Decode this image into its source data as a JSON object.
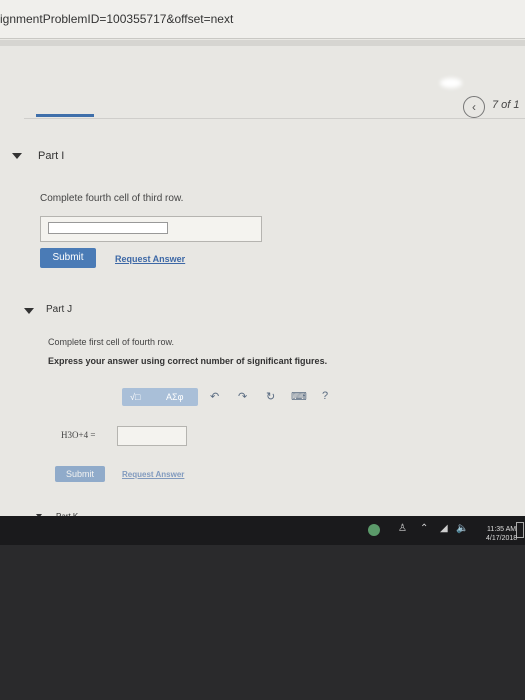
{
  "browser": {
    "url": "ignmentProblemID=100355717&offset=next"
  },
  "nav": {
    "back_icon": "chevron-left-icon",
    "pager_label": "7 of 1"
  },
  "part_i": {
    "title": "Part I",
    "prompt": "Complete fourth cell of third row.",
    "submit_label": "Submit",
    "request_label": "Request Answer"
  },
  "part_j": {
    "title": "Part J",
    "prompt": "Complete first cell of fourth row.",
    "instructions": "Express your answer using correct number of significant figures.",
    "toolbar": {
      "template_label": "√□",
      "greek_label": "ΑΣφ",
      "help_label": "?"
    },
    "formula_label": "H3O+4 =",
    "submit_label": "Submit",
    "request_label": "Request Answer"
  },
  "part_k": {
    "title": "Part K"
  },
  "taskbar": {
    "time": "11:35 AM",
    "date": "4/17/2018"
  },
  "colors": {
    "accent": "#4a7bb6",
    "link": "#3d68a6",
    "background": "#e8e7e3"
  }
}
